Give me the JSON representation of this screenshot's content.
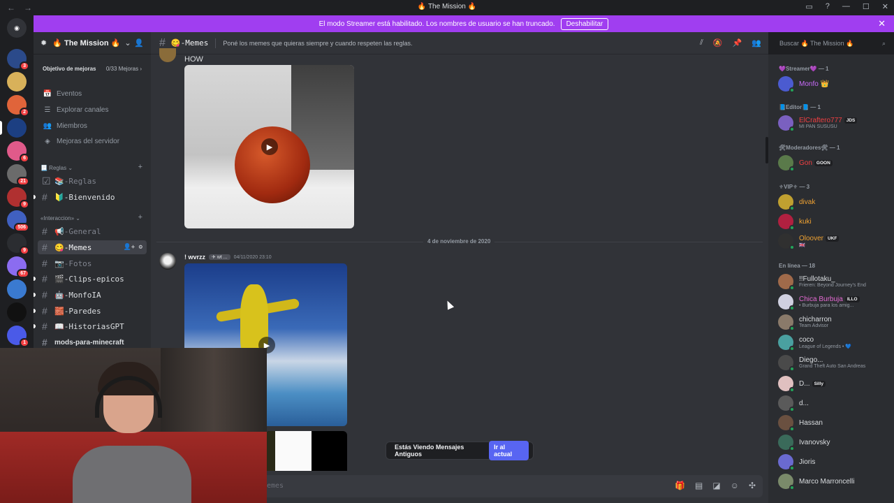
{
  "window": {
    "title": "The Mission",
    "nav_back": "←",
    "nav_forward": "→",
    "controls": [
      "▭",
      "?",
      "—",
      "☐",
      "✕"
    ]
  },
  "banner": {
    "text": "El modo Streamer está habilitado. Los nombres de usuario se han truncado.",
    "button": "Deshabilitar",
    "close": "✕"
  },
  "servers": [
    {
      "badge": "3",
      "color": "#2b4a8a"
    },
    {
      "badge": "",
      "color": "#d8b15a"
    },
    {
      "badge": "2",
      "color": "#e0643a"
    },
    {
      "badge": "",
      "color": "#1c3f82"
    },
    {
      "badge": "6",
      "color": "#e05a8a"
    },
    {
      "badge": "21",
      "color": "#6b6b6b"
    },
    {
      "badge": "9",
      "color": "#b03030"
    },
    {
      "badge": "506",
      "color": "#4060c0"
    },
    {
      "badge": "9",
      "color": "#2b2d31"
    },
    {
      "badge": "67",
      "color": "#8b6cf0"
    },
    {
      "badge": "",
      "color": "#3a7ad0"
    },
    {
      "badge": "",
      "color": "#111111"
    },
    {
      "badge": "1",
      "color": "#4a5ae8"
    },
    {
      "badge": "",
      "color": "#c04050"
    }
  ],
  "sidebar": {
    "server_name": "The Mission",
    "boost_label": "Objetivo de mejoras",
    "boost_count": "0/33 Mejoras",
    "menu": [
      {
        "label": "Eventos",
        "icon": "📅"
      },
      {
        "label": "Explorar canales",
        "icon": "☰"
      },
      {
        "label": "Miembros",
        "icon": "👥"
      },
      {
        "label": "Mejoras del servidor",
        "icon": "◈"
      }
    ],
    "category_reglas": "📃 Reglas",
    "category_interaccion": "«Interaccion»",
    "channels_reglas": [
      {
        "name": "📚-Reglas",
        "muted": true,
        "icon": "☑"
      },
      {
        "name": "🔰-Bienvenido",
        "muted": false,
        "icon": "#"
      }
    ],
    "channels_interaccion": [
      {
        "name": "📢-General",
        "muted": true
      },
      {
        "name": "😋-Memes",
        "active": true
      },
      {
        "name": "📷-Fotos",
        "muted": true
      },
      {
        "name": "🎬-Clips-epicos"
      },
      {
        "name": "🤖-MonfoIA"
      },
      {
        "name": "🧱-Paredes"
      },
      {
        "name": "📖-HistoriasGPT"
      },
      {
        "name": "mods-para-minecraft"
      }
    ]
  },
  "chat": {
    "channel": "😋-Memes",
    "topic": "Poné los memes que quieras siempre y cuando respeten las reglas.",
    "first_message": "HOW",
    "date_divider": "4 de noviembre de 2020",
    "author": "! wvrzz",
    "author_tag": "✈ wt ...",
    "timestamp": "04/11/2020 23:10",
    "old_messages": "Estás Viendo Mensajes Antiguos",
    "jump_button": "Ir al actual",
    "composer_placeholder": "emes"
  },
  "search": {
    "placeholder": "Buscar 🔥 The Mission 🔥"
  },
  "members": {
    "roles": [
      {
        "label": "💜Streamer💜 — 1"
      },
      {
        "label": "📘Editor📘 — 1"
      },
      {
        "label": "🛠Moderadores🛠 — 1"
      },
      {
        "label": "⚜VIP⚜ — 3"
      },
      {
        "label": "En línea — 18"
      }
    ],
    "list": [
      {
        "name": "Monfo 👑",
        "color": "#c86bfa",
        "sub": "",
        "tag": "",
        "av": "#4b5bd0"
      },
      {
        "name": "ElCraftero777",
        "color": "#f23f42",
        "sub": "MI PAN SUSUSU",
        "tag": "JDS",
        "av": "#7a60c0"
      },
      {
        "name": "Gon",
        "color": "#f23f42",
        "sub": "",
        "tag": "GOON",
        "av": "#5a7a4a"
      },
      {
        "name": "divak",
        "color": "#f0a232",
        "sub": "",
        "tag": "",
        "av": "#c0a030"
      },
      {
        "name": "kuki",
        "color": "#f0a232",
        "sub": "",
        "tag": "",
        "av": "#b02040"
      },
      {
        "name": "Oloover",
        "color": "#f0a232",
        "sub": "🇬🇧",
        "tag": "UKF",
        "av": "#303030"
      },
      {
        "name": "!!Fullotaku_",
        "color": "#dbdee1",
        "sub": "Frieren: Beyond Journey's End",
        "tag": "",
        "av": "#a06a4a"
      },
      {
        "name": "Chica Burbuja",
        "color": "#e46ad2",
        "sub": "• Burbuja para los amig...",
        "tag": "ILLO",
        "av": "#d0d0e0"
      },
      {
        "name": "chicharron",
        "color": "#dbdee1",
        "sub": "Team Advisor",
        "tag": "",
        "av": "#8a7a6a"
      },
      {
        "name": "coco",
        "color": "#dbdee1",
        "sub": "League of Legends • 💙",
        "tag": "",
        "av": "#4aa0a0"
      },
      {
        "name": "Diego...",
        "color": "#dbdee1",
        "sub": "Grand Theft Auto San Andreas",
        "tag": "",
        "av": "#4a4a4a"
      },
      {
        "name": "D...",
        "color": "#dbdee1",
        "sub": "",
        "tag": "Silly",
        "av": "#e0c0c0"
      },
      {
        "name": "d...",
        "color": "#dbdee1",
        "sub": "",
        "tag": "",
        "av": "#5a5a5a"
      },
      {
        "name": "Hassan",
        "color": "#dbdee1",
        "sub": "",
        "tag": "",
        "av": "#6a5040"
      },
      {
        "name": "Ivanovsky",
        "color": "#dbdee1",
        "sub": "",
        "tag": "",
        "av": "#3a6a5a"
      },
      {
        "name": "Jioris",
        "color": "#dbdee1",
        "sub": "",
        "tag": "",
        "av": "#6a6ad0"
      },
      {
        "name": "Marco Marroncelli",
        "color": "#dbdee1",
        "sub": "",
        "tag": "",
        "av": "#7a8a6a"
      }
    ]
  }
}
